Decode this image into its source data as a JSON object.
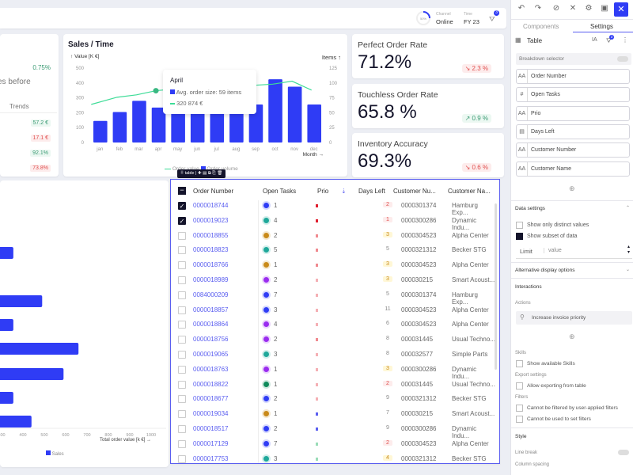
{
  "topbar": {
    "progress_label": "50%",
    "channel_label": "Channel",
    "channel_value": "Online",
    "time_label": "Time",
    "time_value": "FY 23",
    "filter_badge": "3"
  },
  "left_kpi": {
    "delta": "0.75%",
    "text": "es before",
    "trends_header": "Trends",
    "trends": [
      {
        "v": "57.2 €",
        "s": "pos"
      },
      {
        "v": "17.1 €",
        "s": "neg"
      },
      {
        "v": "92.1%",
        "s": "pos"
      },
      {
        "v": "73.8%",
        "s": "neg"
      }
    ]
  },
  "sales_chart": {
    "title": "Sales / Time",
    "left_axis_label": "Value [K €]",
    "right_axis_label": "Items",
    "x_axis_label": "Month",
    "legend": [
      "Order value",
      "Order volume"
    ],
    "tooltip": {
      "title": "April",
      "line1": "Avg. order size: 59 items",
      "line2": "320 874 €"
    }
  },
  "chart_data": [
    {
      "type": "bar",
      "title": "Sales / Time",
      "categories": [
        "jan",
        "feb",
        "mar",
        "apr",
        "may",
        "jun",
        "jul",
        "aug",
        "sep",
        "oct",
        "nov",
        "dec"
      ],
      "y_left": {
        "label": "Value [K €]",
        "ylim": [
          0,
          500
        ],
        "ticks": [
          0,
          100,
          200,
          300,
          400,
          500
        ]
      },
      "y_right": {
        "label": "Items",
        "ylim": [
          0,
          125
        ],
        "ticks": [
          0,
          25,
          50,
          75,
          100,
          125
        ]
      },
      "series": [
        {
          "name": "Order volume",
          "type": "bar",
          "values": [
            145,
            205,
            280,
            235,
            235,
            235,
            235,
            235,
            255,
            425,
            375,
            255
          ]
        },
        {
          "name": "Order value",
          "type": "line",
          "values": [
            64,
            76,
            80,
            87,
            90,
            88,
            92,
            94,
            96,
            98,
            103,
            88
          ]
        }
      ],
      "colors": {
        "bar": "#2f3cf5",
        "line": "#3ddc97"
      }
    },
    {
      "type": "bar",
      "orientation": "horizontal",
      "xlabel": "Total order value [k €]",
      "x_ticks": [
        300,
        400,
        500,
        600,
        700,
        800,
        900,
        1000
      ],
      "legend": [
        "Sales"
      ],
      "values": [
        355,
        490,
        355,
        660,
        590,
        355,
        440
      ]
    }
  ],
  "kpis": [
    {
      "title": "Perfect Order Rate",
      "value": "71.2%",
      "delta": "2.3 %",
      "trend": "neg"
    },
    {
      "title": "Touchless Order Rate",
      "value": "65.8 %",
      "delta": "0.9 %",
      "trend": "pos"
    },
    {
      "title": "Inventory Accuracy",
      "value": "69.3%",
      "delta": "0.6 %",
      "trend": "neg"
    }
  ],
  "table": {
    "toolbar_label": "table",
    "headers": [
      "Order Number",
      "Open Tasks",
      "Prio",
      "Days Left",
      "Customer Nu...",
      "Customer Na..."
    ],
    "rows": [
      {
        "checked": true,
        "order": "0000018744",
        "tasks": "1",
        "tc": "#2f3cf5",
        "prio": "#e02030",
        "days": "2",
        "dc": "neg",
        "cust": "0000301374",
        "name": "Hamburg Exp..."
      },
      {
        "checked": true,
        "order": "0000019023",
        "tasks": "4",
        "tc": "#1fa89a",
        "prio": "#e02030",
        "days": "1",
        "dc": "neg",
        "cust": "0000300286",
        "name": "Dynamic Indu..."
      },
      {
        "checked": false,
        "order": "0000018855",
        "tasks": "2",
        "tc": "#c98a1a",
        "prio": "#f08a90",
        "days": "3",
        "dc": "warn",
        "cust": "0000304523",
        "name": "Alpha Center"
      },
      {
        "checked": false,
        "order": "0000018823",
        "tasks": "5",
        "tc": "#1fa89a",
        "prio": "#f08a90",
        "days": "5",
        "dc": "",
        "cust": "0000321312",
        "name": "Becker STG"
      },
      {
        "checked": false,
        "order": "0000018766",
        "tasks": "1",
        "tc": "#c98a1a",
        "prio": "#f08a90",
        "days": "3",
        "dc": "warn",
        "cust": "0000304523",
        "name": "Alpha Center"
      },
      {
        "checked": false,
        "order": "0000018989",
        "tasks": "2",
        "tc": "#9a2cf0",
        "prio": "#f5b0b5",
        "days": "3",
        "dc": "warn",
        "cust": "000030215",
        "name": "Smart Acoust..."
      },
      {
        "checked": false,
        "order": "0084000209",
        "tasks": "7",
        "tc": "#2f3cf5",
        "prio": "#f5b0b5",
        "days": "5",
        "dc": "",
        "cust": "0000301374",
        "name": "Hamburg Exp..."
      },
      {
        "checked": false,
        "order": "0000018857",
        "tasks": "3",
        "tc": "#2f3cf5",
        "prio": "#f5b0b5",
        "days": "11",
        "dc": "",
        "cust": "0000304523",
        "name": "Alpha Center"
      },
      {
        "checked": false,
        "order": "0000018864",
        "tasks": "4",
        "tc": "#9a2cf0",
        "prio": "#f5b0b5",
        "days": "6",
        "dc": "",
        "cust": "0000304523",
        "name": "Alpha Center"
      },
      {
        "checked": false,
        "order": "0000018756",
        "tasks": "2",
        "tc": "#9a2cf0",
        "prio": "#f08a90",
        "days": "8",
        "dc": "",
        "cust": "000031445",
        "name": "Usual Techno..."
      },
      {
        "checked": false,
        "order": "0000019065",
        "tasks": "3",
        "tc": "#1fa89a",
        "prio": "#f5b0b5",
        "days": "8",
        "dc": "",
        "cust": "000032577",
        "name": "Simple Parts"
      },
      {
        "checked": false,
        "order": "0000018763",
        "tasks": "1",
        "tc": "#9a2cf0",
        "prio": "#f5b0b5",
        "days": "3",
        "dc": "warn",
        "cust": "0000300286",
        "name": "Dynamic Indu..."
      },
      {
        "checked": false,
        "order": "0000018822",
        "tasks": "1",
        "tc": "#0e8a5a",
        "prio": "#f5b0b5",
        "days": "2",
        "dc": "neg",
        "cust": "000031445",
        "name": "Usual Techno..."
      },
      {
        "checked": false,
        "order": "0000018677",
        "tasks": "2",
        "tc": "#2f3cf5",
        "prio": "#f5b0b5",
        "days": "9",
        "dc": "",
        "cust": "0000321312",
        "name": "Becker STG"
      },
      {
        "checked": false,
        "order": "0000019034",
        "tasks": "1",
        "tc": "#c98a1a",
        "prio": "#5a5ef0",
        "days": "7",
        "dc": "",
        "cust": "000030215",
        "name": "Smart Acoust..."
      },
      {
        "checked": false,
        "order": "0000018517",
        "tasks": "2",
        "tc": "#2f3cf5",
        "prio": "#5a5ef0",
        "days": "9",
        "dc": "",
        "cust": "0000300286",
        "name": "Dynamic Indu..."
      },
      {
        "checked": false,
        "order": "0000017129",
        "tasks": "7",
        "tc": "#2f3cf5",
        "prio": "#9adcb8",
        "days": "2",
        "dc": "neg",
        "cust": "0000304523",
        "name": "Alpha Center"
      },
      {
        "checked": false,
        "order": "0000017753",
        "tasks": "3",
        "tc": "#1fa89a",
        "prio": "#9adcb8",
        "days": "4",
        "dc": "warn",
        "cust": "0000321312",
        "name": "Becker STG"
      }
    ]
  },
  "panel": {
    "tabs": [
      "Components",
      "Settings"
    ],
    "active_tab": "Settings",
    "component": "Table",
    "filter_badge": "3",
    "breakdown": "Breakdown selector",
    "fields": [
      {
        "icon": "AA",
        "label": "Order Number"
      },
      {
        "icon": "#",
        "label": "Open Tasks"
      },
      {
        "icon": "AA",
        "label": "Prio"
      },
      {
        "icon": "▤",
        "label": "Days Left"
      },
      {
        "icon": "AA",
        "label": "Customer Number"
      },
      {
        "icon": "AA",
        "label": "Customer Name"
      }
    ],
    "data_settings": "Data settings",
    "distinct": "Show only distinct values",
    "subset": "Show subset of data",
    "limit_label": "Limit",
    "limit_placeholder": "value",
    "alt_display": "Alternative display options",
    "interactions": "Interactions",
    "actions": "Actions",
    "action_item": "Increase invoice priority",
    "skills": "Skills",
    "show_skills": "Show available Skills",
    "export_settings": "Export settings",
    "allow_export": "Allow exporting from table",
    "filters": "Filters",
    "filter1": "Cannot be filtered by user-applied filters",
    "filter2": "Cannot be used to set filters",
    "style": "Style",
    "line_break": "Line break",
    "column_spacing": "Column spacing"
  },
  "colors": {
    "accent": "#2f3cf5",
    "positive": "#3a9a73",
    "negative": "#e0504f"
  }
}
